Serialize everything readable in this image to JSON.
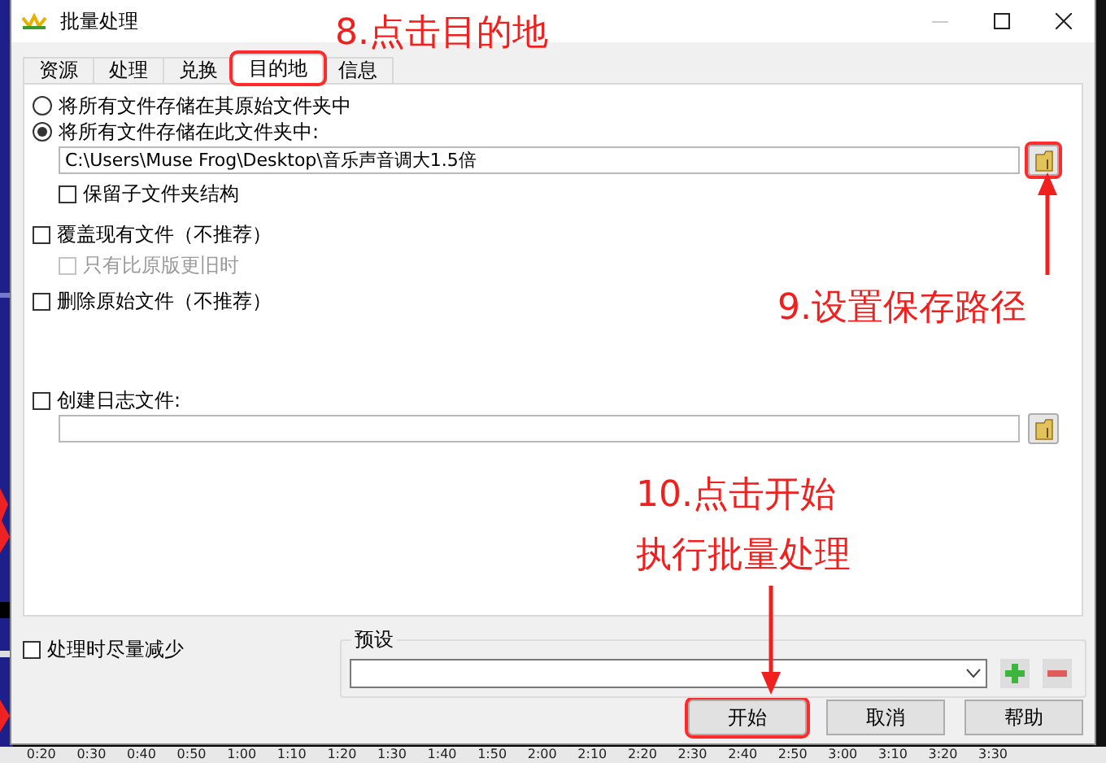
{
  "window": {
    "title": "批量处理"
  },
  "tabs": [
    {
      "label": "资源",
      "selected": false,
      "highlighted": false
    },
    {
      "label": "处理",
      "selected": false,
      "highlighted": false
    },
    {
      "label": "兑换",
      "selected": false,
      "highlighted": false
    },
    {
      "label": "目的地",
      "selected": true,
      "highlighted": true
    },
    {
      "label": "信息",
      "selected": false,
      "highlighted": false
    }
  ],
  "destination": {
    "options": [
      {
        "label": "将所有文件存储在其原始文件夹中",
        "selected": false
      },
      {
        "label": "将所有文件存储在此文件夹中:",
        "selected": true
      }
    ],
    "path": "C:\\Users\\Muse Frog\\Desktop\\音乐声音调大1.5倍",
    "browse_highlighted": true,
    "keep_structure": {
      "label": "保留子文件夹结构",
      "checked": false
    }
  },
  "options": [
    {
      "label": "覆盖现有文件（不推荐）",
      "checked": false,
      "disabled": false,
      "children": [
        {
          "label": "只有比原版更旧时",
          "checked": false,
          "disabled": true
        }
      ]
    },
    {
      "label": "删除原始文件（不推荐）",
      "checked": false,
      "disabled": false
    }
  ],
  "log": {
    "label": "创建日志文件:",
    "checked": false,
    "browse_highlighted": false
  },
  "minimize": {
    "label": "处理时尽量减少",
    "checked": false
  },
  "preset": {
    "label": "预设"
  },
  "buttons": [
    {
      "label": "开始",
      "highlighted": true
    },
    {
      "label": "取消",
      "highlighted": false
    },
    {
      "label": "帮助",
      "highlighted": false
    }
  ],
  "annotations": [
    {
      "lines": [
        "8.点击目的地"
      ]
    },
    {
      "lines": [
        "9.设置保存路径"
      ]
    },
    {
      "lines": [
        "10.点击开始",
        "执行批量处理"
      ]
    }
  ],
  "timeline": [
    "0:20",
    "0:30",
    "0:40",
    "0:50",
    "1:00",
    "1:10",
    "1:20",
    "1:30",
    "1:40",
    "1:50",
    "2:00",
    "2:10",
    "2:20",
    "2:30",
    "2:40",
    "2:50",
    "3:00",
    "3:10",
    "3:20",
    "3:30"
  ]
}
